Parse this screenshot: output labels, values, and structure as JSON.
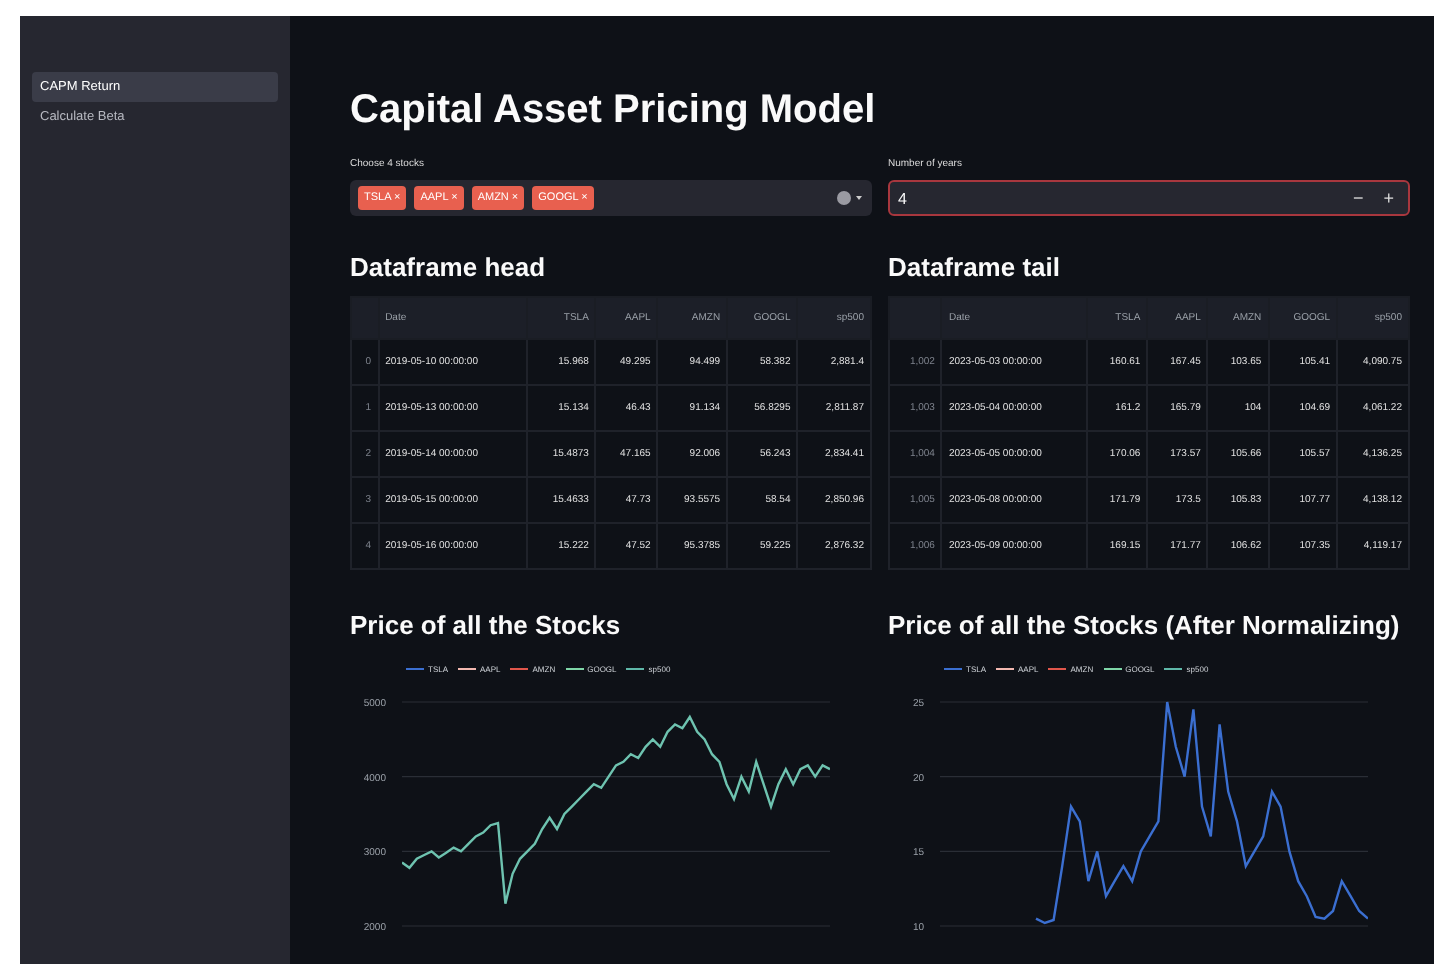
{
  "sidebar": {
    "items": [
      {
        "label": "CAPM Return",
        "selected": true
      },
      {
        "label": "Calculate Beta",
        "selected": false
      }
    ]
  },
  "title": "Capital Asset Pricing Model",
  "stocks_select": {
    "label": "Choose 4 stocks",
    "tags": [
      "TSLA",
      "AAPL",
      "AMZN",
      "GOOGL"
    ],
    "tag_remove": "×"
  },
  "years_input": {
    "label": "Number of years",
    "value": "4",
    "decrement": "−",
    "increment": "+"
  },
  "tables": [
    {
      "title": "Dataframe head",
      "columns": [
        "",
        "Date",
        "TSLA",
        "AAPL",
        "AMZN",
        "GOOGL",
        "sp500"
      ],
      "rows": [
        [
          "0",
          "2019-05-10 00:00:00",
          "15.968",
          "49.295",
          "94.499",
          "58.382",
          "2,881.4"
        ],
        [
          "1",
          "2019-05-13 00:00:00",
          "15.134",
          "46.43",
          "91.134",
          "56.8295",
          "2,811.87"
        ],
        [
          "2",
          "2019-05-14 00:00:00",
          "15.4873",
          "47.165",
          "92.006",
          "56.243",
          "2,834.41"
        ],
        [
          "3",
          "2019-05-15 00:00:00",
          "15.4633",
          "47.73",
          "93.5575",
          "58.54",
          "2,850.96"
        ],
        [
          "4",
          "2019-05-16 00:00:00",
          "15.222",
          "47.52",
          "95.3785",
          "59.225",
          "2,876.32"
        ]
      ]
    },
    {
      "title": "Dataframe tail",
      "columns": [
        "",
        "Date",
        "TSLA",
        "AAPL",
        "AMZN",
        "GOOGL",
        "sp500"
      ],
      "rows": [
        [
          "1,002",
          "2023-05-03 00:00:00",
          "160.61",
          "167.45",
          "103.65",
          "105.41",
          "4,090.75"
        ],
        [
          "1,003",
          "2023-05-04 00:00:00",
          "161.2",
          "165.79",
          "104",
          "104.69",
          "4,061.22"
        ],
        [
          "1,004",
          "2023-05-05 00:00:00",
          "170.06",
          "173.57",
          "105.66",
          "105.57",
          "4,136.25"
        ],
        [
          "1,005",
          "2023-05-08 00:00:00",
          "171.79",
          "173.5",
          "105.83",
          "107.77",
          "4,138.12"
        ],
        [
          "1,006",
          "2023-05-09 00:00:00",
          "169.15",
          "171.77",
          "106.62",
          "107.35",
          "4,119.17"
        ]
      ]
    }
  ],
  "charts": [
    {
      "title": "Price of all the Stocks",
      "legend": [
        {
          "name": "TSLA",
          "color": "#3b6fd1"
        },
        {
          "name": "AAPL",
          "color": "#f2b8b0"
        },
        {
          "name": "AMZN",
          "color": "#e0564b"
        },
        {
          "name": "GOOGL",
          "color": "#7fd6a8"
        },
        {
          "name": "sp500",
          "color": "#5fb8a9"
        }
      ],
      "chart_data": {
        "type": "line",
        "ylim": [
          2000,
          5000
        ],
        "yticks": [
          2000,
          3000,
          4000,
          5000
        ],
        "grid": true,
        "series": [
          {
            "color": "#6ec3b0",
            "values": [
              2850,
              2780,
              2900,
              2950,
              3000,
              2920,
              2980,
              3050,
              3000,
              3100,
              3200,
              3250,
              3350,
              3380,
              2300,
              2700,
              2900,
              3000,
              3100,
              3300,
              3450,
              3300,
              3500,
              3600,
              3700,
              3800,
              3900,
              3850,
              4000,
              4150,
              4200,
              4300,
              4250,
              4400,
              4500,
              4400,
              4600,
              4700,
              4650,
              4800,
              4600,
              4500,
              4300,
              4200,
              3900,
              3700,
              4000,
              3800,
              4200,
              3900,
              3600,
              3900,
              4100,
              3900,
              4100,
              4150,
              4000,
              4150,
              4100
            ]
          }
        ]
      }
    },
    {
      "title": "Price of all the Stocks (After Normalizing)",
      "legend": [
        {
          "name": "TSLA",
          "color": "#3b6fd1"
        },
        {
          "name": "AAPL",
          "color": "#f2b8b0"
        },
        {
          "name": "AMZN",
          "color": "#e0564b"
        },
        {
          "name": "GOOGL",
          "color": "#7fd6a8"
        },
        {
          "name": "sp500",
          "color": "#5fb8a9"
        }
      ],
      "chart_data": {
        "type": "line",
        "ylim": [
          10,
          25
        ],
        "yticks": [
          10,
          15,
          20,
          25
        ],
        "grid": true,
        "series": [
          {
            "color": "#3b6fd1",
            "values": [
              null,
              null,
              null,
              null,
              null,
              null,
              null,
              null,
              null,
              null,
              null,
              10.5,
              10.2,
              10.4,
              14,
              18,
              17,
              13,
              15,
              12,
              13,
              14,
              13,
              15,
              16,
              17,
              25,
              22,
              20,
              24.5,
              18,
              16,
              23.5,
              19,
              17,
              14,
              15,
              16,
              19,
              18,
              15,
              13,
              12,
              10.6,
              10.5,
              11,
              13,
              12,
              11,
              10.5
            ]
          }
        ]
      }
    }
  ]
}
